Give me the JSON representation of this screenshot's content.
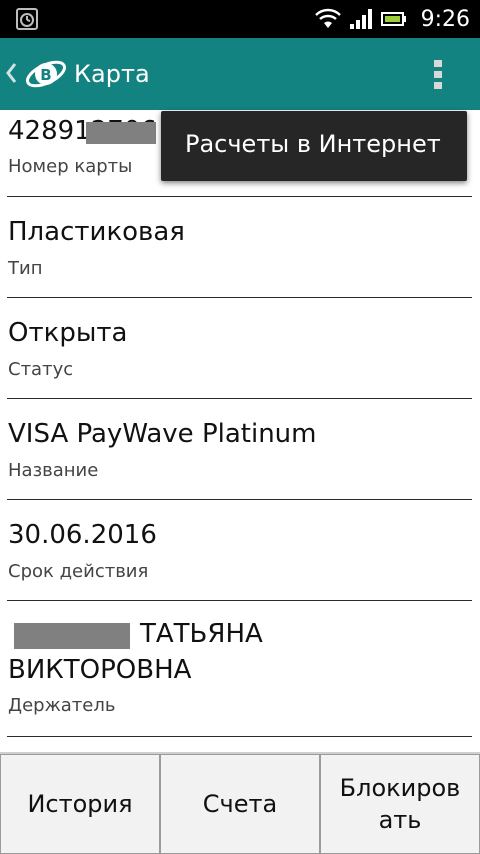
{
  "status_bar": {
    "time": "9:26",
    "icons": [
      "alarm-icon",
      "wifi-icon",
      "signal-icon",
      "battery-icon"
    ]
  },
  "action_bar": {
    "title": "Карта",
    "background_color": "#138382",
    "icons": [
      "back-chevron-icon",
      "app-logo-icon",
      "overflow-menu-icon"
    ]
  },
  "popup_menu": {
    "items": [
      {
        "label": "Расчеты в Интернет"
      }
    ]
  },
  "card_details": {
    "items": [
      {
        "value": "428912706",
        "label": "Номер карты"
      },
      {
        "value": "Пластиковая",
        "label": "Тип"
      },
      {
        "value": "Открыта",
        "label": "Статус"
      },
      {
        "value": "VISA PayWave Platinum",
        "label": "Название"
      },
      {
        "value": "30.06.2016",
        "label": "Срок действия"
      },
      {
        "value_line1": "ТАТЬЯНА",
        "value_line2": "ВИКТОРОВНА",
        "label": "Держатель"
      }
    ]
  },
  "bottom_buttons": {
    "history": "История",
    "accounts": "Счета",
    "block_line1": "Блокиров",
    "block_line2": "ать"
  }
}
